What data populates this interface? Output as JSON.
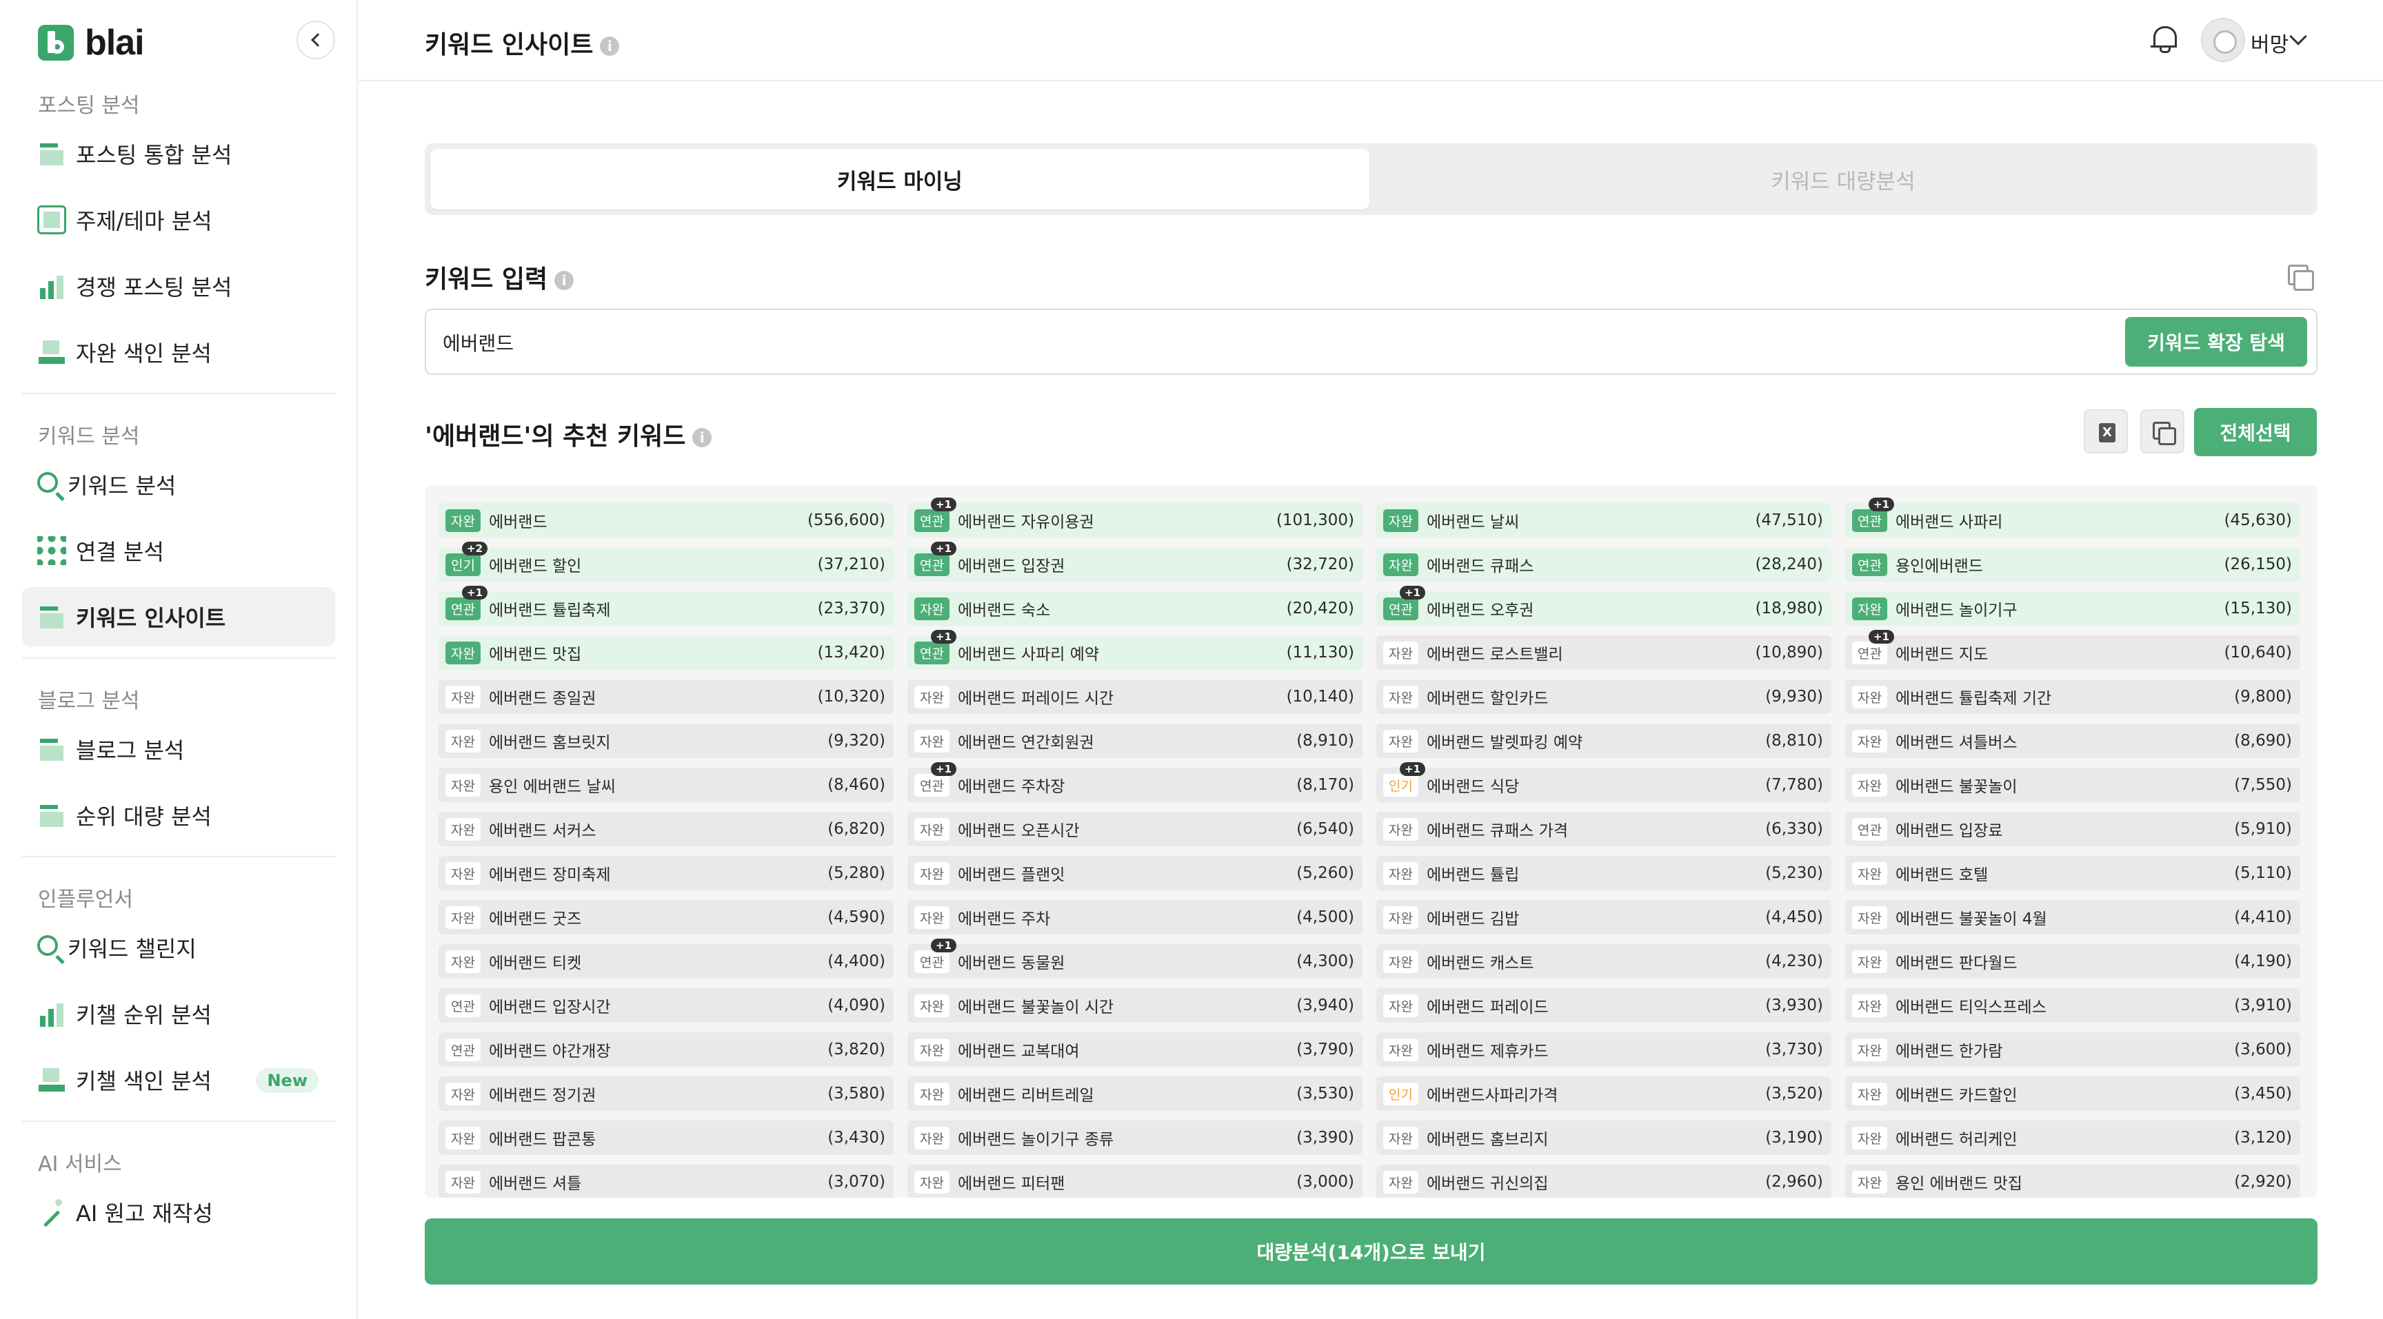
{
  "brand": {
    "name": "blai",
    "accent": "#4caf77"
  },
  "sidebar": {
    "sections": [
      {
        "title": "포스팅 분석",
        "items": [
          {
            "label": "포스팅 통합 분석",
            "icon": "posting-integrated-icon"
          },
          {
            "label": "주제/테마 분석",
            "icon": "theme-icon"
          },
          {
            "label": "경쟁 포스팅 분석",
            "icon": "competition-chart-icon"
          },
          {
            "label": "자완 색인 분석",
            "icon": "index-icon"
          }
        ]
      },
      {
        "title": "키워드 분석",
        "items": [
          {
            "label": "키워드 분석",
            "icon": "keyword-search-icon"
          },
          {
            "label": "연결 분석",
            "icon": "connection-icon"
          },
          {
            "label": "키워드 인사이트",
            "icon": "insight-icon",
            "active": true
          }
        ]
      },
      {
        "title": "블로그 분석",
        "items": [
          {
            "label": "블로그 분석",
            "icon": "blog-icon"
          },
          {
            "label": "순위 대량 분석",
            "icon": "rank-bulk-icon"
          }
        ]
      },
      {
        "title": "인플루언서",
        "items": [
          {
            "label": "키워드 챌린지",
            "icon": "challenge-icon"
          },
          {
            "label": "키챌 순위 분석",
            "icon": "challenge-rank-icon"
          },
          {
            "label": "키챌 색인 분석",
            "icon": "challenge-index-icon",
            "badge": "New"
          }
        ]
      },
      {
        "title": "AI 서비스",
        "items": [
          {
            "label": "AI 원고 재작성",
            "icon": "ai-rewrite-icon"
          }
        ]
      }
    ]
  },
  "header": {
    "title": "키워드 인사이트",
    "info": "i",
    "username": "버망"
  },
  "tabs": [
    {
      "label": "키워드 마이닝",
      "active": true
    },
    {
      "label": "키워드 대량분석",
      "active": false
    }
  ],
  "keyword_input": {
    "label": "키워드 입력",
    "value": "에버랜드",
    "button": "키워드 확장 탐색"
  },
  "results": {
    "title": "'에버랜드'의 추천 키워드",
    "excel_icon": "X",
    "select_all": "전체선택",
    "keywords": [
      {
        "tag": "자완",
        "name": "에버랜드",
        "vol": "(556,600)",
        "sel": true
      },
      {
        "tag": "연관",
        "name": "에버랜드 자유이용권",
        "vol": "(101,300)",
        "sel": true,
        "plus": "+1"
      },
      {
        "tag": "자완",
        "name": "에버랜드 날씨",
        "vol": "(47,510)",
        "sel": true
      },
      {
        "tag": "연관",
        "name": "에버랜드 사파리",
        "vol": "(45,630)",
        "sel": true,
        "plus": "+1"
      },
      {
        "tag": "인기",
        "name": "에버랜드 할인",
        "vol": "(37,210)",
        "sel": true,
        "plus": "+2"
      },
      {
        "tag": "연관",
        "name": "에버랜드 입장권",
        "vol": "(32,720)",
        "sel": true,
        "plus": "+1"
      },
      {
        "tag": "자완",
        "name": "에버랜드 큐패스",
        "vol": "(28,240)",
        "sel": true
      },
      {
        "tag": "연관",
        "name": "용인에버랜드",
        "vol": "(26,150)",
        "sel": true
      },
      {
        "tag": "연관",
        "name": "에버랜드 튤립축제",
        "vol": "(23,370)",
        "sel": true,
        "plus": "+1"
      },
      {
        "tag": "자완",
        "name": "에버랜드 숙소",
        "vol": "(20,420)",
        "sel": true
      },
      {
        "tag": "연관",
        "name": "에버랜드 오후권",
        "vol": "(18,980)",
        "sel": true,
        "plus": "+1"
      },
      {
        "tag": "자완",
        "name": "에버랜드 놀이기구",
        "vol": "(15,130)",
        "sel": true
      },
      {
        "tag": "자완",
        "name": "에버랜드 맛집",
        "vol": "(13,420)",
        "sel": true
      },
      {
        "tag": "연관",
        "name": "에버랜드 사파리 예약",
        "vol": "(11,130)",
        "sel": true,
        "plus": "+1"
      },
      {
        "tag": "자완",
        "name": "에버랜드 로스트밸리",
        "vol": "(10,890)"
      },
      {
        "tag": "연관",
        "name": "에버랜드 지도",
        "vol": "(10,640)",
        "plus": "+1"
      },
      {
        "tag": "자완",
        "name": "에버랜드 종일권",
        "vol": "(10,320)"
      },
      {
        "tag": "자완",
        "name": "에버랜드 퍼레이드 시간",
        "vol": "(10,140)"
      },
      {
        "tag": "자완",
        "name": "에버랜드 할인카드",
        "vol": "(9,930)"
      },
      {
        "tag": "자완",
        "name": "에버랜드 튤립축제 기간",
        "vol": "(9,800)"
      },
      {
        "tag": "자완",
        "name": "에버랜드 홈브릿지",
        "vol": "(9,320)"
      },
      {
        "tag": "자완",
        "name": "에버랜드 연간회원권",
        "vol": "(8,910)"
      },
      {
        "tag": "자완",
        "name": "에버랜드 발렛파킹 예약",
        "vol": "(8,810)"
      },
      {
        "tag": "자완",
        "name": "에버랜드 셔틀버스",
        "vol": "(8,690)"
      },
      {
        "tag": "자완",
        "name": "용인 에버랜드 날씨",
        "vol": "(8,460)"
      },
      {
        "tag": "연관",
        "name": "에버랜드 주차장",
        "vol": "(8,170)",
        "plus": "+1"
      },
      {
        "tag": "인기",
        "name": "에버랜드 식당",
        "vol": "(7,780)",
        "plus": "+1"
      },
      {
        "tag": "자완",
        "name": "에버랜드 불꽃놀이",
        "vol": "(7,550)"
      },
      {
        "tag": "자완",
        "name": "에버랜드 서커스",
        "vol": "(6,820)"
      },
      {
        "tag": "자완",
        "name": "에버랜드 오픈시간",
        "vol": "(6,540)"
      },
      {
        "tag": "자완",
        "name": "에버랜드 큐패스 가격",
        "vol": "(6,330)"
      },
      {
        "tag": "연관",
        "name": "에버랜드 입장료",
        "vol": "(5,910)"
      },
      {
        "tag": "자완",
        "name": "에버랜드 장미축제",
        "vol": "(5,280)"
      },
      {
        "tag": "자완",
        "name": "에버랜드 플랜잇",
        "vol": "(5,260)"
      },
      {
        "tag": "자완",
        "name": "에버랜드 튤립",
        "vol": "(5,230)"
      },
      {
        "tag": "자완",
        "name": "에버랜드 호텔",
        "vol": "(5,110)"
      },
      {
        "tag": "자완",
        "name": "에버랜드 굿즈",
        "vol": "(4,590)"
      },
      {
        "tag": "자완",
        "name": "에버랜드 주차",
        "vol": "(4,500)"
      },
      {
        "tag": "자완",
        "name": "에버랜드 김밥",
        "vol": "(4,450)"
      },
      {
        "tag": "자완",
        "name": "에버랜드 불꽃놀이 4월",
        "vol": "(4,410)"
      },
      {
        "tag": "자완",
        "name": "에버랜드 티켓",
        "vol": "(4,400)"
      },
      {
        "tag": "연관",
        "name": "에버랜드 동물원",
        "vol": "(4,300)",
        "plus": "+1"
      },
      {
        "tag": "자완",
        "name": "에버랜드 캐스트",
        "vol": "(4,230)"
      },
      {
        "tag": "자완",
        "name": "에버랜드 판다월드",
        "vol": "(4,190)"
      },
      {
        "tag": "연관",
        "name": "에버랜드 입장시간",
        "vol": "(4,090)"
      },
      {
        "tag": "자완",
        "name": "에버랜드 불꽃놀이 시간",
        "vol": "(3,940)"
      },
      {
        "tag": "자완",
        "name": "에버랜드 퍼레이드",
        "vol": "(3,930)"
      },
      {
        "tag": "자완",
        "name": "에버랜드 티익스프레스",
        "vol": "(3,910)"
      },
      {
        "tag": "연관",
        "name": "에버랜드 야간개장",
        "vol": "(3,820)"
      },
      {
        "tag": "자완",
        "name": "에버랜드 교복대여",
        "vol": "(3,790)"
      },
      {
        "tag": "자완",
        "name": "에버랜드 제휴카드",
        "vol": "(3,730)"
      },
      {
        "tag": "자완",
        "name": "에버랜드 한가람",
        "vol": "(3,600)"
      },
      {
        "tag": "자완",
        "name": "에버랜드 정기권",
        "vol": "(3,580)"
      },
      {
        "tag": "자완",
        "name": "에버랜드 리버트레일",
        "vol": "(3,530)"
      },
      {
        "tag": "인기",
        "name": "에버랜드사파리가격",
        "vol": "(3,520)"
      },
      {
        "tag": "자완",
        "name": "에버랜드 카드할인",
        "vol": "(3,450)"
      },
      {
        "tag": "자완",
        "name": "에버랜드 팝콘통",
        "vol": "(3,430)"
      },
      {
        "tag": "자완",
        "name": "에버랜드 놀이기구 종류",
        "vol": "(3,390)"
      },
      {
        "tag": "자완",
        "name": "에버랜드 홈브리지",
        "vol": "(3,190)"
      },
      {
        "tag": "자완",
        "name": "에버랜드 허리케인",
        "vol": "(3,120)"
      },
      {
        "tag": "자완",
        "name": "에버랜드 셔틀",
        "vol": "(3,070)"
      },
      {
        "tag": "자완",
        "name": "에버랜드 피터팬",
        "vol": "(3,000)"
      },
      {
        "tag": "자완",
        "name": "에버랜드 귀신의집",
        "vol": "(2,960)"
      },
      {
        "tag": "자완",
        "name": "용인 에버랜드 맛집",
        "vol": "(2,920)"
      }
    ]
  },
  "bulk_button": "대량분석(14개)으로 보내기"
}
